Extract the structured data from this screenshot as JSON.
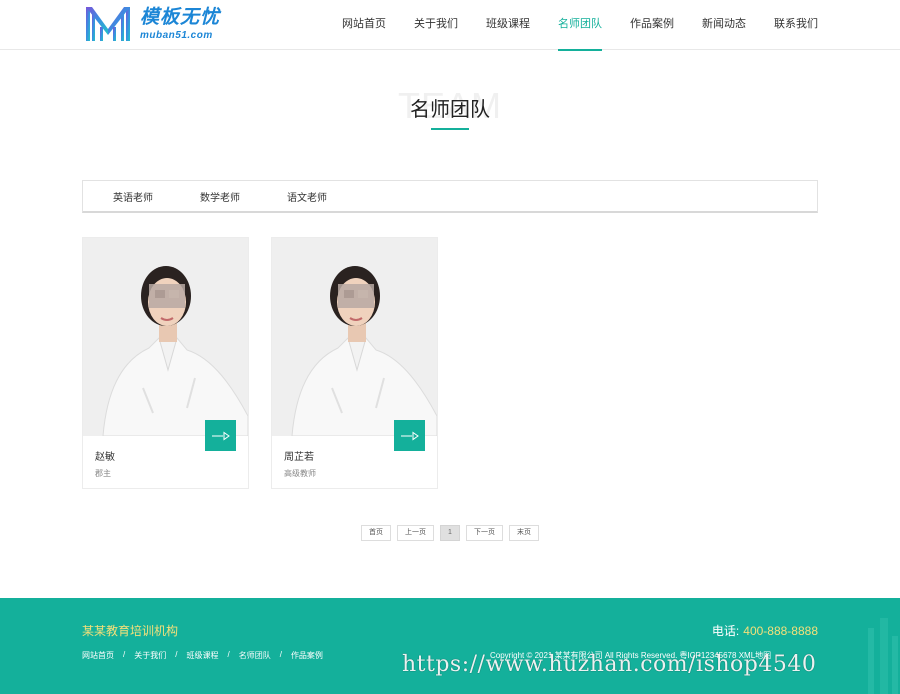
{
  "header": {
    "logo": {
      "cn": "模板无忧",
      "en": "muban51.com"
    },
    "nav": [
      {
        "label": "网站首页",
        "active": false
      },
      {
        "label": "关于我们",
        "active": false
      },
      {
        "label": "班级课程",
        "active": false
      },
      {
        "label": "名师团队",
        "active": true
      },
      {
        "label": "作品案例",
        "active": false
      },
      {
        "label": "新闻动态",
        "active": false
      },
      {
        "label": "联系我们",
        "active": false
      }
    ]
  },
  "section": {
    "title": "名师团队",
    "bg_text": "TEAM"
  },
  "tabs": [
    "英语老师",
    "数学老师",
    "语文老师"
  ],
  "teachers": [
    {
      "name": "赵敏",
      "role": "郡主"
    },
    {
      "name": "周芷若",
      "role": "高级教师"
    }
  ],
  "pagination": [
    "首页",
    "上一页",
    "1",
    "下一页",
    "末页"
  ],
  "footer": {
    "org": "某某教育培训机构",
    "links": [
      "网站首页",
      "关于我们",
      "班级课程",
      "名师团队",
      "作品案例"
    ],
    "phone_label": "电话:",
    "phone_number": "400-888-8888",
    "copyright": "Copyright © 2021 某某有限公司 All Rights Reserved. 粤ICP12345678",
    "xml": "XML地图"
  },
  "watermark": "https://www.huzhan.com/ishop4540",
  "colors": {
    "accent": "#14b09b",
    "footer_highlight": "#f4e07a"
  }
}
